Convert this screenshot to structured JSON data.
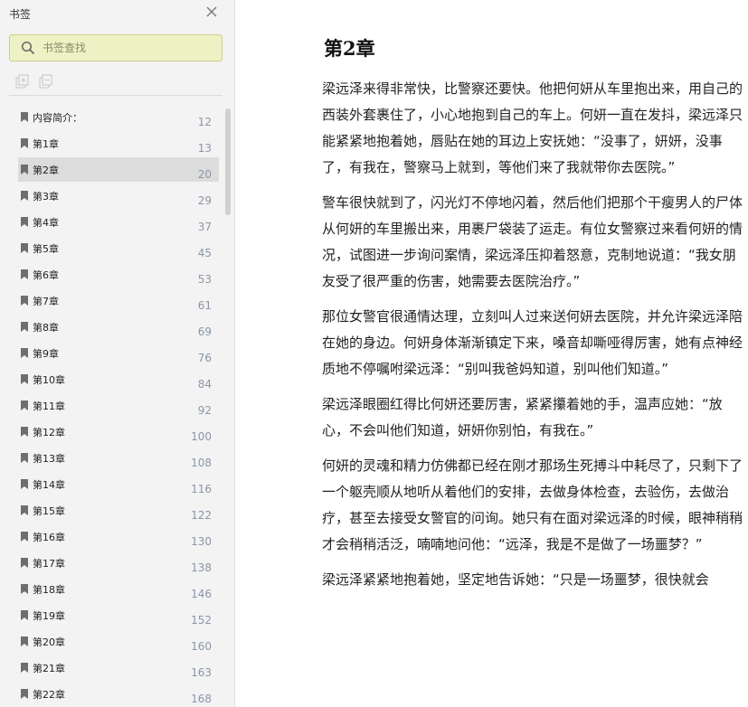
{
  "sidebar": {
    "title": "书签",
    "search": {
      "placeholder": "书签查找",
      "value": ""
    },
    "items": [
      {
        "label": "内容简介：",
        "page": "12",
        "selected": false
      },
      {
        "label": "第1章",
        "page": "13",
        "selected": false
      },
      {
        "label": "第2章",
        "page": "20",
        "selected": true
      },
      {
        "label": "第3章",
        "page": "29",
        "selected": false
      },
      {
        "label": "第4章",
        "page": "37",
        "selected": false
      },
      {
        "label": "第5章",
        "page": "45",
        "selected": false
      },
      {
        "label": "第6章",
        "page": "53",
        "selected": false
      },
      {
        "label": "第7章",
        "page": "61",
        "selected": false
      },
      {
        "label": "第8章",
        "page": "69",
        "selected": false
      },
      {
        "label": "第9章",
        "page": "76",
        "selected": false
      },
      {
        "label": "第10章",
        "page": "84",
        "selected": false
      },
      {
        "label": "第11章",
        "page": "92",
        "selected": false
      },
      {
        "label": "第12章",
        "page": "100",
        "selected": false
      },
      {
        "label": "第13章",
        "page": "108",
        "selected": false
      },
      {
        "label": "第14章",
        "page": "116",
        "selected": false
      },
      {
        "label": "第15章",
        "page": "122",
        "selected": false
      },
      {
        "label": "第16章",
        "page": "130",
        "selected": false
      },
      {
        "label": "第17章",
        "page": "138",
        "selected": false
      },
      {
        "label": "第18章",
        "page": "146",
        "selected": false
      },
      {
        "label": "第19章",
        "page": "152",
        "selected": false
      },
      {
        "label": "第20章",
        "page": "160",
        "selected": false
      },
      {
        "label": "第21章",
        "page": "163",
        "selected": false
      },
      {
        "label": "第22章",
        "page": "168",
        "selected": false
      }
    ]
  },
  "document": {
    "chapter_title": "第2章",
    "paragraphs": [
      "梁远泽来得非常快，比警察还要快。他把何妍从车里抱出来，用自己的西装外套裹住了，小心地抱到自己的车上。何妍一直在发抖，梁远泽只能紧紧地抱着她，唇贴在她的耳边上安抚她：“没事了，妍妍，没事了，有我在，警察马上就到，等他们来了我就带你去医院。”",
      "警车很快就到了，闪光灯不停地闪着，然后他们把那个干瘦男人的尸体从何妍的车里搬出来，用裹尸袋装了运走。有位女警察过来看何妍的情况，试图进一步询问案情，梁远泽压抑着怒意，克制地说道：“我女朋友受了很严重的伤害，她需要去医院治疗。”",
      "那位女警官很通情达理，立刻叫人过来送何妍去医院，并允许梁远泽陪在她的身边。何妍身体渐渐镇定下来，嗓音却嘶哑得厉害，她有点神经质地不停嘱咐梁远泽：“别叫我爸妈知道，别叫他们知道。”",
      "梁远泽眼圈红得比何妍还要厉害，紧紧攥着她的手，温声应她：“放心，不会叫他们知道，妍妍你别怕，有我在。”",
      "何妍的灵魂和精力仿佛都已经在刚才那场生死搏斗中耗尽了，只剩下了一个躯壳顺从地听从着他们的安排，去做身体检查，去验伤，去做治疗，甚至去接受女警官的问询。她只有在面对梁远泽的时候，眼神稍稍才会稍稍活泛，喃喃地问他：“远泽，我是不是做了一场噩梦？”",
      "梁远泽紧紧地抱着她，坚定地告诉她：“只是一场噩梦，很快就会"
    ]
  }
}
